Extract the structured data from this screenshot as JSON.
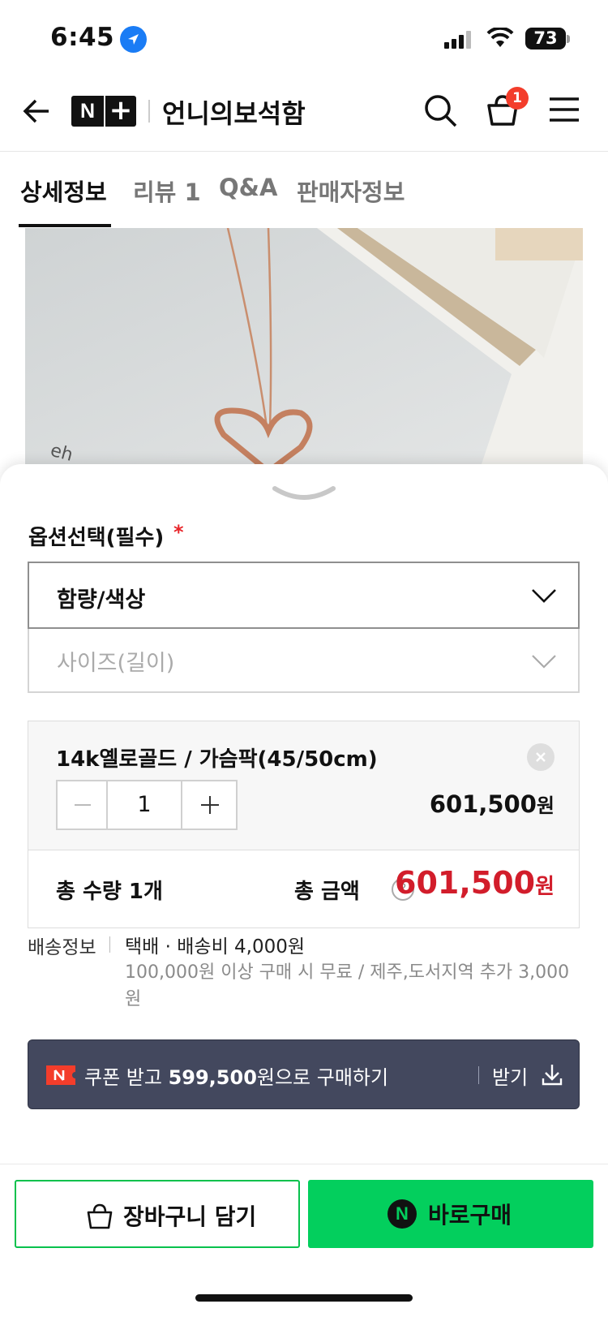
{
  "status_bar": {
    "time": "6:45",
    "battery": "73"
  },
  "header": {
    "store_name": "언니의보석함",
    "brand_n": "N",
    "brand_plus": "+",
    "cart_count": "1"
  },
  "tabs": [
    {
      "label": "상세정보",
      "active": true
    },
    {
      "label": "리뷰 1",
      "active": false
    },
    {
      "label": "Q&A",
      "active": false
    },
    {
      "label": "판매자정보",
      "active": false
    }
  ],
  "options": {
    "title": "옵션선택(필수)",
    "required_mark": "*",
    "select_1": "함량/색상",
    "select_2": "사이즈(길이)"
  },
  "selected_item": {
    "name": "14k옐로골드 / 가슴팍(45/50cm)",
    "quantity": "1",
    "price": "601,500",
    "currency": "원"
  },
  "total": {
    "qty_label": "총 수량 1개",
    "amount_label": "총 금액",
    "help": "?",
    "price": "601,500",
    "currency": "원"
  },
  "shipping": {
    "label": "배송정보",
    "main": "택배 · 배송비 4,000원",
    "sub": "100,000원 이상 구매 시 무료 / 제주,도서지역 추가 3,000원"
  },
  "coupon": {
    "prefix": "쿠폰 받고 ",
    "amount": "599,500",
    "suffix": "원으로 구매하기",
    "get_label": "받기"
  },
  "actions": {
    "cart_label": "장바구니 담기",
    "buy_label": "바로구매",
    "npay_letter": "N"
  },
  "colors": {
    "accent_red": "#d21d2b",
    "badge_red": "#f33d2b",
    "buy_green": "#03cf5d",
    "coupon_bg": "#43485e"
  }
}
